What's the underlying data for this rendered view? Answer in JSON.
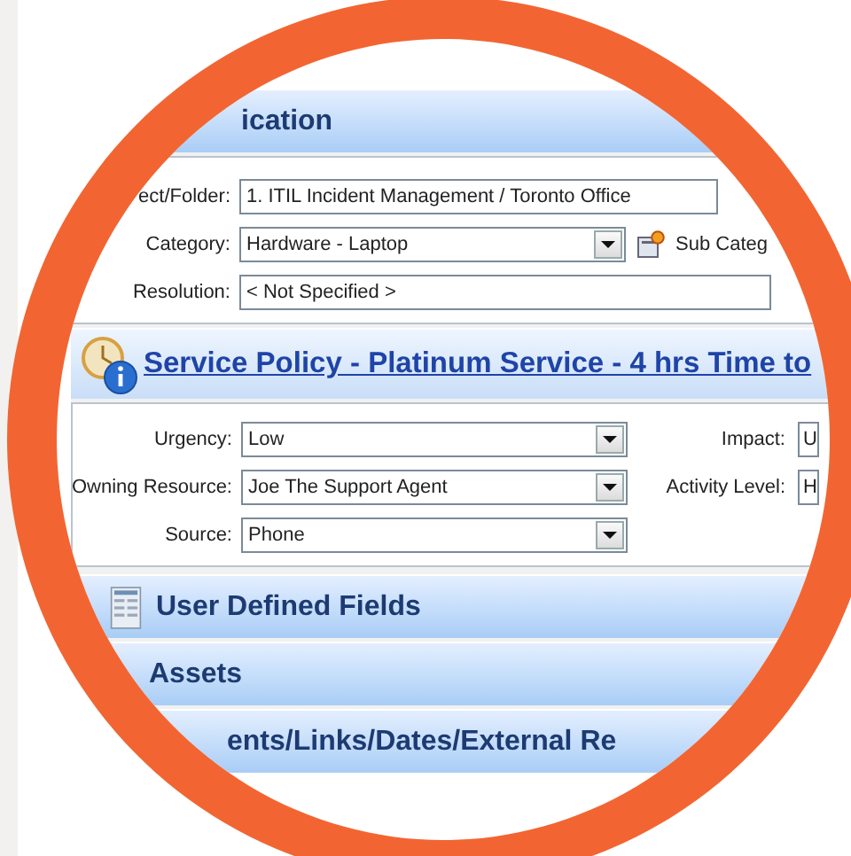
{
  "sections": [
    {
      "kind": "fields",
      "title": "ication",
      "rows": [
        {
          "kind": "text",
          "label": "ect/Folder:",
          "value": "1. ITIL Incident Management / Toronto Office"
        },
        {
          "kind": "combo",
          "label": "Category:",
          "value": "Hardware - Laptop",
          "extra_label": "Sub Categ"
        },
        {
          "kind": "text",
          "label": "Resolution:",
          "value": "< Not Specified >"
        }
      ]
    },
    {
      "kind": "policy",
      "link": "Service Policy - Platinum Service - 4 hrs Time to",
      "rows": [
        {
          "kind": "combo",
          "label": "Urgency:",
          "value": "Low",
          "side_label": "Impact:",
          "side_value": "U"
        },
        {
          "kind": "combo",
          "label": "Owning Resource:",
          "value": "Joe The Support Agent",
          "side_label": "Activity Level:",
          "side_value": "H"
        },
        {
          "kind": "combo",
          "label": "Source:",
          "value": "Phone"
        }
      ]
    },
    {
      "kind": "band_icon",
      "title": "User Defined Fields"
    },
    {
      "kind": "band",
      "title": "Assets"
    },
    {
      "kind": "band_indent",
      "title": "ents/Links/Dates/External Re"
    }
  ]
}
